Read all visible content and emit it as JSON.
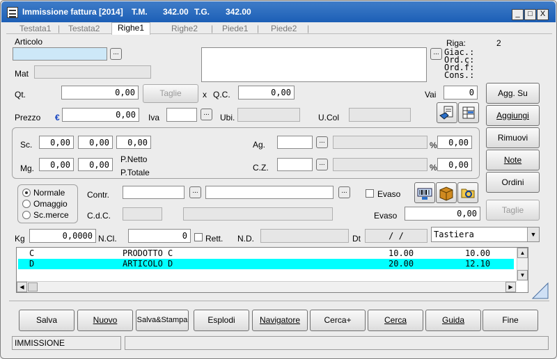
{
  "window": {
    "title": "Immissione fattura [2014]",
    "tm_label": "T.M.",
    "tm_value": "342.00",
    "tg_label": "T.G.",
    "tg_value": "342.00",
    "minimize": "_",
    "maximize": "□",
    "close": "X"
  },
  "tabs": [
    "Testata1",
    "Testata2",
    "Righe1",
    "Righe2",
    "Piede1",
    "Piede2"
  ],
  "active_tab": "Righe1",
  "form": {
    "articolo_label": "Articolo",
    "articolo_value": "",
    "mat_label": "Mat",
    "riga_label": "Riga:",
    "riga_value": "2",
    "giac_label": "Giac.:",
    "ordc_label": "Ord.c:",
    "ordf_label": "Ord.f:",
    "cons_label": "Cons.:",
    "qt_label": "Qt.",
    "qt_value": "0,00",
    "taglie_label": "Taglie",
    "x_label": "x",
    "qc_label": "Q.C.",
    "qc_value": "0,00",
    "vai_label": "Vai",
    "vai_value": "0",
    "prezzo_label": "Prezzo",
    "currency": "€",
    "prezzo_value": "0,00",
    "iva_label": "Iva",
    "ubi_label": "Ubi.",
    "ucol_label": "U.Col",
    "sc_label": "Sc.",
    "sc_values": [
      "0,00",
      "0,00",
      "0,00"
    ],
    "mg_label": "Mg.",
    "mg_values": [
      "0,00",
      "0,00"
    ],
    "pnetto_label": "P.Netto",
    "ptotale_label": "P.Totale",
    "ag_label": "Ag.",
    "ag_pct_value": "0,00",
    "cz_label": "C.Z.",
    "cz_pct_value": "0,00",
    "pct": "%",
    "radio_normale": "Normale",
    "radio_omaggio": "Omaggio",
    "radio_scmerce": "Sc.merce",
    "contr_label": "Contr.",
    "cdc_label": "C.d.C.",
    "evaso_cb_label": "Evaso",
    "evaso_label": "Evaso",
    "evaso_value": "0,00",
    "kg_label": "Kg",
    "kg_value": "0,0000",
    "ncl_label": "N.Cl.",
    "ncl_value": "0",
    "rett_label": "Rett.",
    "nd_label": "N.D.",
    "dt_label": "Dt",
    "dt_value": "/    /",
    "input_mode": "Tastiera"
  },
  "side_buttons": {
    "agg_su": "Agg. Su",
    "aggiungi": "Aggiungi",
    "rimuovi": "Rimuovi",
    "note": "Note",
    "ordini": "Ordini",
    "taglie": "Taglie"
  },
  "grid": {
    "rows": [
      {
        "code": "C",
        "desc": "PRODOTTO C",
        "qty": "10.00",
        "price": "10.00"
      },
      {
        "code": "D",
        "desc": "ARTICOLO D",
        "qty": "20.00",
        "price": "12.10"
      }
    ]
  },
  "bottom_buttons": [
    "Salva",
    "Nuovo",
    "Salva&Stampa",
    "Esplodi",
    "Navigatore",
    "Cerca+",
    "Cerca",
    "Guida",
    "Fine"
  ],
  "status": {
    "mode": "IMMISSIONE",
    "message": ""
  },
  "colors": {
    "titlebar": "#1c5fb6",
    "articolo_focus": "#cde8f8",
    "grid_selected": "#00ffff"
  }
}
